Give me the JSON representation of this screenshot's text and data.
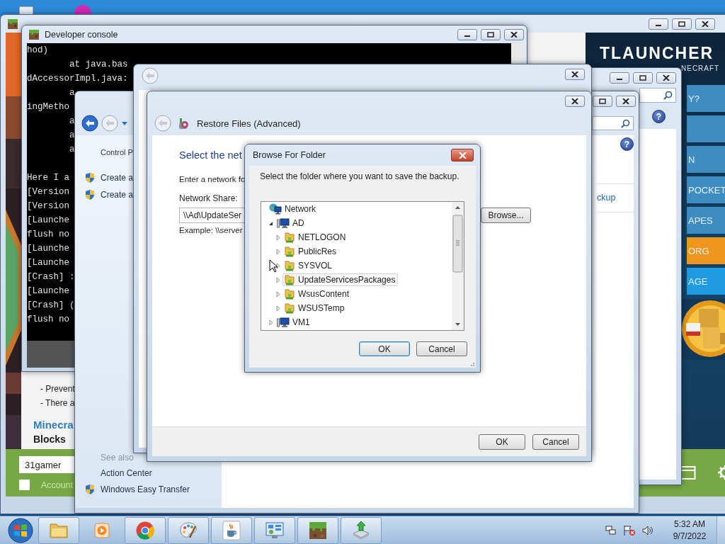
{
  "launcher": {
    "brand": "TLAUNCHER",
    "tagline": "NECRAFT",
    "menu": [
      {
        "label": "Y?",
        "color": "#3d8cc2"
      },
      {
        "color": "#3d8cc2"
      },
      {
        "label": "N",
        "color": "#3d8cc2"
      },
      {
        "label": "POCKET",
        "color": "#3d8cc2"
      },
      {
        "label": "APES",
        "color": "#3d8cc2"
      },
      {
        "label": "ORG",
        "color": "#f0951e"
      },
      {
        "label": "AGE",
        "color": "#1f9be3"
      }
    ],
    "news": {
      "lines": [
        "- Prevent",
        "- There a"
      ],
      "heading": "Minecra",
      "subheading": "Blocks"
    },
    "username": "31gamer",
    "remember": {
      "label": "Account",
      "checked": false
    }
  },
  "console": {
    "title": "Developer console",
    "line_groups": [
      [
        "hod)",
        "        at java.bas",
        "dAccessorImpl.java:",
        "        a",
        "ingMetho",
        "        a",
        "        a",
        "        a"
      ],
      [
        "Here I a",
        "[Version",
        "[Version",
        "[Launche",
        "flush no",
        "[Launche",
        "[Launche",
        "[Crash] :",
        "[Launche",
        "[Crash] (",
        "flush no"
      ]
    ]
  },
  "control_panel_back": {
    "help": "?"
  },
  "control_panel": {
    "breadcrumb": "Control P",
    "help": "?",
    "tasks": [
      {
        "label": "Create a",
        "shield": true
      },
      {
        "label": "Create a",
        "shield": true
      }
    ],
    "see_also_heading": "See also",
    "see_also": [
      {
        "label": "Action Center",
        "shield": false
      },
      {
        "label": "Windows Easy Transfer",
        "shield": true
      }
    ],
    "link": "ckup"
  },
  "restore": {
    "title": "Restore Files (Advanced)",
    "heading": "Select the net",
    "instruction": "Enter a network fo",
    "share_label": "Network Share:",
    "share_value": "\\\\Ad\\UpdateSer",
    "example": "Example: \\\\server",
    "browse_button": "Browse...",
    "buttons": [
      "OK",
      "Cancel"
    ]
  },
  "browse_dialog": {
    "title": "Browse For Folder",
    "prompt": "Select the folder where you want to save the backup.",
    "tree": {
      "label": "Network",
      "kind": "network",
      "selected": false,
      "children": [
        {
          "label": "AD",
          "kind": "computer",
          "expanded": true,
          "selected": false,
          "children": [
            {
              "label": "NETLOGON",
              "kind": "share",
              "expanded": false,
              "selected": false
            },
            {
              "label": "PublicRes",
              "kind": "share",
              "expanded": false,
              "selected": false
            },
            {
              "label": "SYSVOL",
              "kind": "share",
              "expanded": false,
              "selected": false
            },
            {
              "label": "UpdateServicesPackages",
              "kind": "share",
              "expanded": false,
              "selected": true
            },
            {
              "label": "WsusContent",
              "kind": "share",
              "expanded": false,
              "selected": false
            },
            {
              "label": "WSUSTemp",
              "kind": "share",
              "expanded": false,
              "selected": false
            }
          ]
        },
        {
          "label": "VM1",
          "kind": "computer",
          "expanded": false,
          "selected": false
        }
      ]
    },
    "buttons": [
      {
        "label": "OK",
        "default": true
      },
      {
        "label": "Cancel",
        "default": false
      }
    ]
  },
  "taskbar": {
    "apps": [
      {
        "kind": "folder",
        "running": true
      },
      {
        "kind": "media",
        "running": false
      },
      {
        "kind": "browser",
        "running": true
      },
      {
        "kind": "paint",
        "running": true
      },
      {
        "kind": "java",
        "running": true
      },
      {
        "kind": "control",
        "running": true
      },
      {
        "kind": "block",
        "running": true
      },
      {
        "kind": "backup",
        "running": true
      }
    ],
    "time": "5:32 AM",
    "date": "9/7/2022"
  }
}
